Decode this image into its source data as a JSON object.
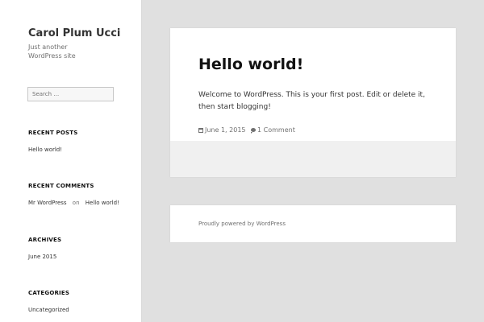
{
  "site": {
    "title": "Carol Plum Ucci",
    "description": "Just another WordPress site"
  },
  "search": {
    "placeholder": "Search …"
  },
  "widgets": {
    "recent_posts": {
      "title": "RECENT POSTS",
      "items": [
        "Hello world!"
      ]
    },
    "recent_comments": {
      "title": "RECENT COMMENTS",
      "author": "Mr WordPress",
      "on": "on",
      "post": "Hello world!"
    },
    "archives": {
      "title": "ARCHIVES",
      "items": [
        "June 2015"
      ]
    },
    "categories": {
      "title": "CATEGORIES",
      "items": [
        "Uncategorized"
      ]
    }
  },
  "post": {
    "title": "Hello world!",
    "content": "Welcome to WordPress. This is your first post. Edit or delete it, then start blogging!",
    "date": "June 1, 2015",
    "comments": "1 Comment"
  },
  "footer": {
    "text": "Proudly powered by WordPress"
  },
  "colors": {
    "page_background": "#e0e0e0",
    "card_background": "#ffffff",
    "post_footer_background": "#f0f0f0"
  }
}
